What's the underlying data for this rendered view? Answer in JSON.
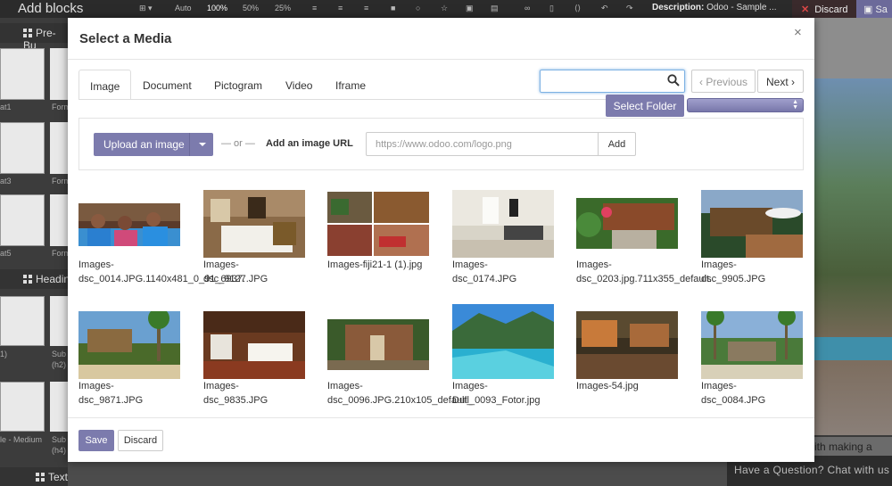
{
  "editor": {
    "title": "Add blocks",
    "zoom_auto": "Auto",
    "zoom_100": "100%",
    "zoom_50": "50%",
    "zoom_25": "25%",
    "description_label": "Description:",
    "description_value": "Odoo - Sample ...",
    "discard_label": "Discard",
    "save_label_partial": "Sa"
  },
  "left_panel": {
    "section_prebuilt": "Pre-Bu",
    "section_headings": "Headin",
    "section_text": "Text",
    "labels": [
      "at1",
      "Form",
      "at3",
      "Form",
      "at5",
      "Form",
      "1)",
      "Sub",
      "(h2)",
      "le - Medium",
      "Sub",
      "(h4)"
    ]
  },
  "right_bg": {
    "band_text": "ith making a",
    "chat_text": "Have a Question? Chat with us"
  },
  "modal": {
    "title": "Select a Media",
    "close_symbol": "×",
    "tabs": [
      {
        "label": "Image"
      },
      {
        "label": "Document"
      },
      {
        "label": "Pictogram"
      },
      {
        "label": "Video"
      },
      {
        "label": "Iframe"
      }
    ],
    "search": {
      "value": "",
      "placeholder": ""
    },
    "pager": {
      "previous": "‹ Previous",
      "next": "Next ›"
    },
    "select_folder_label": "Select Folder",
    "upload": {
      "button_label": "Upload an image",
      "or_text": "— or —",
      "url_label": "Add an image URL",
      "url_placeholder": "https://www.odoo.com/logo.png",
      "add_label": "Add"
    },
    "images": [
      {
        "line1": "Images-",
        "line2": "dsc_0014.JPG.1140x481_0_91_6937.",
        "overlap": "dsc_9127.JPG"
      },
      {
        "line1": "Images-",
        "line2": ""
      },
      {
        "line1": "Images-fiji21-1 (1).jpg",
        "line2": ""
      },
      {
        "line1": "Images-",
        "line2": "dsc_0174.JPG"
      },
      {
        "line1": "Images-",
        "line2": "dsc_0203.jpg.711x355_default.",
        "overlap": "dsc_9905.JPG"
      },
      {
        "line1": "Images-",
        "line2": ""
      },
      {
        "line1": "Images-",
        "line2": "dsc_9871.JPG"
      },
      {
        "line1": "Images-",
        "line2": "dsc_9835.JPG"
      },
      {
        "line1": "Images-",
        "line2": "dsc_0096.JPG.210x105_default_",
        "overlap": "Dull_0093_Fotor.jpg"
      },
      {
        "line1": "Images-",
        "line2": ""
      },
      {
        "line1": "Images-54.jpg",
        "line2": ""
      },
      {
        "line1": "Images-",
        "line2": "dsc_0084.JPG"
      }
    ],
    "footer": {
      "save_label": "Save",
      "discard_label": "Discard"
    }
  },
  "colors": {
    "accent": "#7c7bad",
    "focus": "#7db1e3"
  }
}
